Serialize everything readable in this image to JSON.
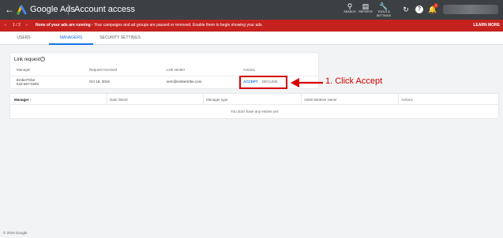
{
  "appbar": {
    "product": "Google Ads",
    "title": "Account access",
    "tools": [
      {
        "icon": "search-icon",
        "label": "SEARCH"
      },
      {
        "icon": "reports-icon",
        "label": "REPORTS"
      },
      {
        "icon": "tools-icon",
        "label": "TOOLS & SETTINGS"
      }
    ],
    "notification_count": "1"
  },
  "banner": {
    "pager": "1 / 2",
    "message_bold": "None of your ads are running",
    "message_rest": " - Your campaigns and ad groups are paused or removed. Enable them to begin showing your ads.",
    "action": "LEARN MORE"
  },
  "tabs": [
    {
      "label": "USERS"
    },
    {
      "label": "MANAGERS",
      "active": true
    },
    {
      "label": "SECURITY SETTINGS"
    }
  ],
  "link_request": {
    "title": "Link request",
    "columns": [
      "Manager",
      "Request received",
      "Link sender",
      "Actions"
    ],
    "row": {
      "manager_name": "EmberTribe",
      "manager_id": "532-667-0283",
      "received": "Oct 18, 2019",
      "sender": "sem@embertribe.com",
      "accept": "ACCEPT",
      "decline": "DECLINE"
    }
  },
  "annotation": {
    "text": "1. Click Accept",
    "color": "#d50000"
  },
  "managers_table": {
    "columns": [
      "Manager",
      "Date linked",
      "Manager type",
      "Administrative owner",
      "Actions"
    ],
    "empty_message": "You don't have any entries yet"
  },
  "footer": "© 2019 Google"
}
